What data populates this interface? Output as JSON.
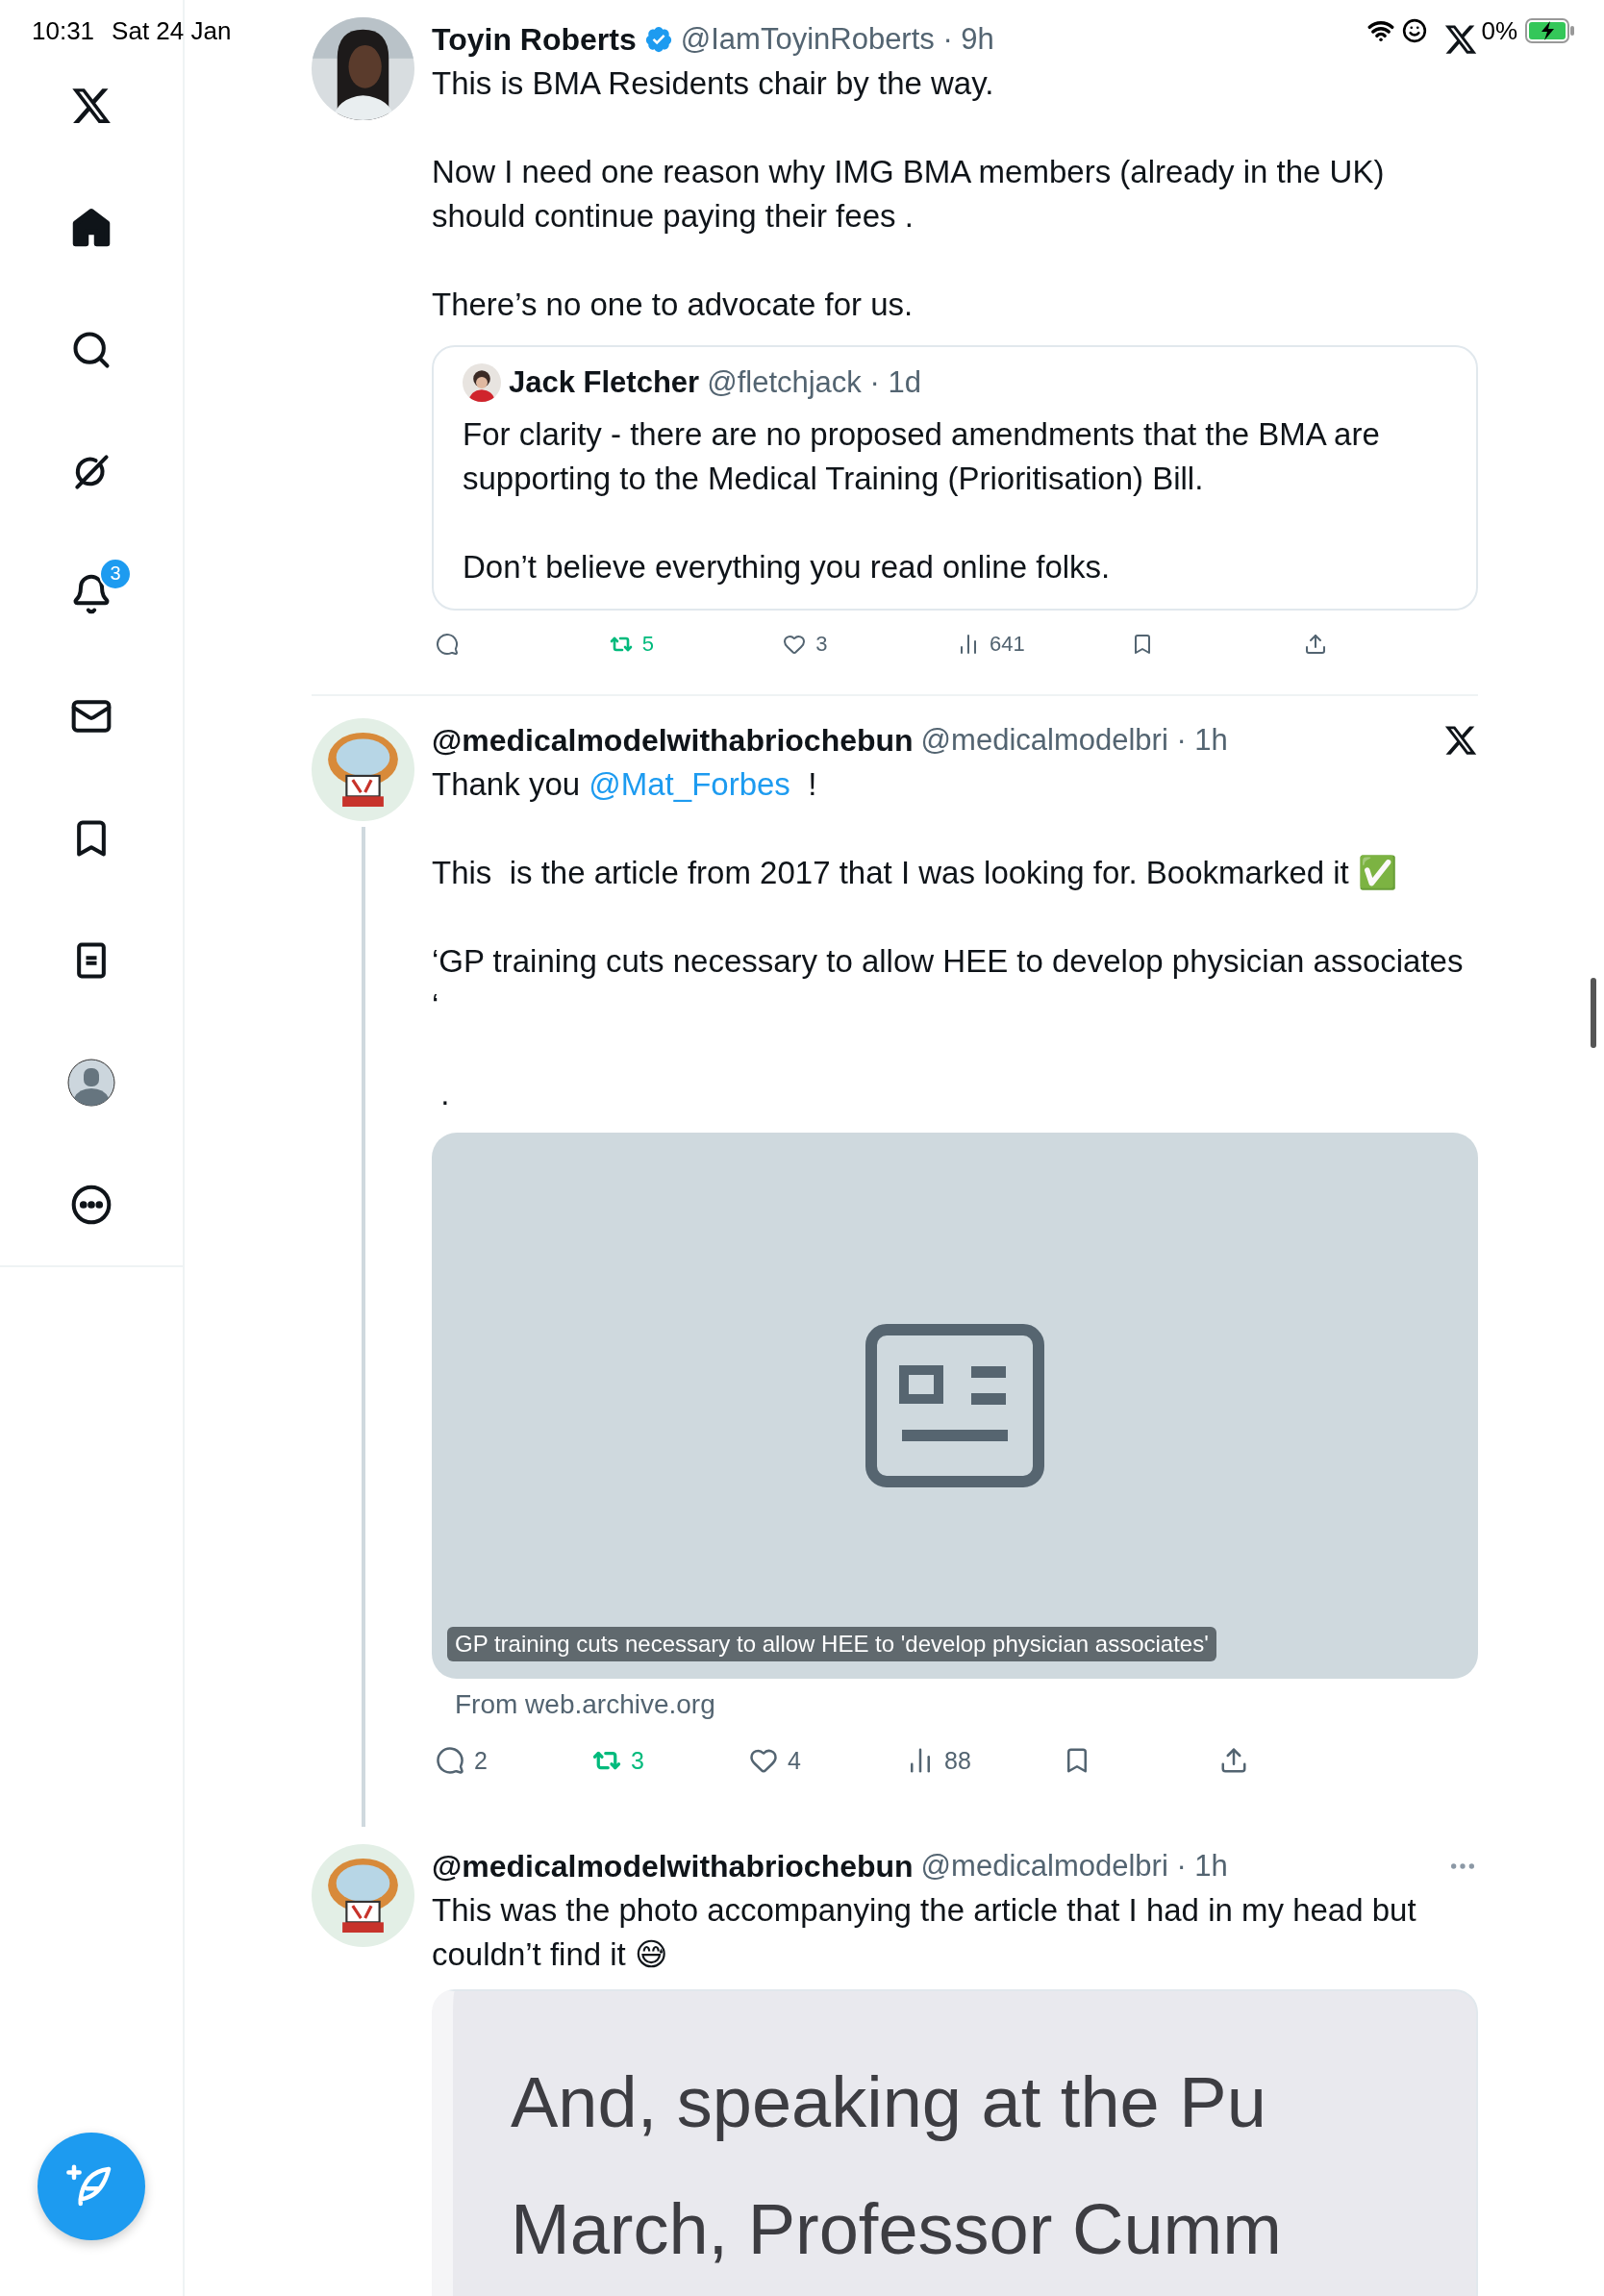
{
  "status_bar": {
    "time": "10:31",
    "date": "Sat 24 Jan",
    "battery": "0%"
  },
  "sidebar": {
    "items": [
      {
        "kind": "logo",
        "selected": false
      },
      {
        "kind": "home",
        "selected": true
      },
      {
        "kind": "search",
        "selected": false
      },
      {
        "kind": "grok",
        "selected": false
      },
      {
        "kind": "notifications",
        "selected": false,
        "badge": "3"
      },
      {
        "kind": "messages",
        "selected": false
      },
      {
        "kind": "bookmarks",
        "selected": false
      },
      {
        "kind": "lists",
        "selected": false
      },
      {
        "kind": "profile",
        "selected": false
      },
      {
        "kind": "more",
        "selected": false
      }
    ]
  },
  "tweets": [
    {
      "name": "Toyin Roberts",
      "verified": true,
      "meta": "@IamToyinRoberts · 9h",
      "corner": {
        "kind": "logo"
      },
      "thread_line": false,
      "paragraphs": [
        [
          {
            "text": "This is BMA Residents chair by the way."
          }
        ],
        [
          {
            "text": "Now I need one reason why IMG BMA members (already in the UK) should continue paying their fees ."
          }
        ],
        [
          {
            "text": "There’s no one to advocate for us."
          }
        ]
      ],
      "quote": {
        "name": "Jack Fletcher",
        "meta": "@fletchjack · 1d",
        "paragraphs": [
          [
            {
              "text": "For clarity - there are no proposed amendments that the BMA are supporting to the Medical Training (Prioritisation) Bill."
            }
          ],
          [
            {
              "text": "Don’t believe everything you read online folks."
            }
          ]
        ]
      },
      "actions": [
        {
          "kind": "reply"
        },
        {
          "kind": "repost",
          "count": "5",
          "active": true
        },
        {
          "kind": "like",
          "count": "3",
          "active": false
        },
        {
          "kind": "views",
          "count": "641"
        },
        {
          "kind": "bookmark",
          "active": false
        },
        {
          "kind": "share"
        }
      ]
    },
    {
      "name": "@medicalmodelwithabriochebun",
      "verified": false,
      "meta": "@medicalmodelbri · 1h",
      "corner": {
        "kind": "logo"
      },
      "thread_line": true,
      "paragraphs": [
        [
          {
            "text": "Thank you "
          },
          {
            "text": "@Mat_Forbes",
            "kind": "mention"
          },
          {
            "text": "  !"
          }
        ],
        [
          {
            "text": "This  is the article from 2017 that I was looking for. Bookmarked it ✅"
          }
        ],
        [
          {
            "text": "‘GP training cuts necessary to allow HEE to develop physician associates ‘"
          }
        ],
        [
          {
            "text": " ."
          }
        ]
      ],
      "link_card": {
        "caption": "GP training cuts necessary to allow HEE to 'develop physician associates'",
        "source": "From web.archive.org"
      },
      "actions": [
        {
          "kind": "reply",
          "count": "2"
        },
        {
          "kind": "repost",
          "count": "3",
          "active": true
        },
        {
          "kind": "like",
          "count": "4",
          "active": false
        },
        {
          "kind": "views",
          "count": "88"
        },
        {
          "kind": "bookmark",
          "active": false
        },
        {
          "kind": "share"
        }
      ]
    },
    {
      "name": "@medicalmodelwithabriochebun",
      "verified": false,
      "meta": "@medicalmodelbri · 1h",
      "corner": {
        "kind": "more"
      },
      "thread_line": false,
      "paragraphs": [
        [
          {
            "text": "This was the photo accompanying the article that I had in my head but couldn’t find it 😅"
          }
        ]
      ],
      "media": {
        "lines": [
          "And, speaking at the Pu",
          "March, Professor Cumm"
        ]
      }
    }
  ]
}
